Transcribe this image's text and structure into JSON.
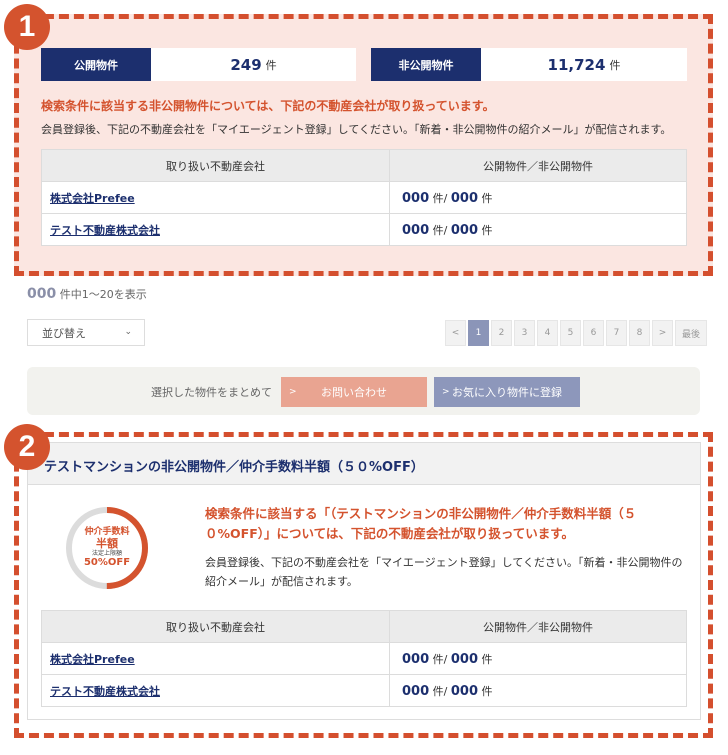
{
  "badges": {
    "one": "1",
    "two": "2"
  },
  "stats": {
    "public": {
      "label": "公開物件",
      "value": "249",
      "unit": "件"
    },
    "private": {
      "label": "非公開物件",
      "value": "11,724",
      "unit": "件"
    }
  },
  "section1": {
    "notice_red": "検索条件に該当する非公開物件については、下記の不動産会社が取り扱っています。",
    "notice_body": "会員登録後、下記の不動産会社を「マイエージェント登録」してください。「新着・非公開物件の紹介メール」が配信されます。",
    "table": {
      "headers": [
        "取り扱い不動産会社",
        "公開物件／非公開物件"
      ],
      "rows": [
        {
          "name": "株式会社Prefee",
          "pub": "000",
          "pub_unit": "件/",
          "priv": "000",
          "priv_unit": "件"
        },
        {
          "name": "テスト不動産株式会社",
          "pub": "000",
          "pub_unit": "件/",
          "priv": "000",
          "priv_unit": "件"
        }
      ]
    }
  },
  "results": {
    "count": "000",
    "text": "件中1～20を表示"
  },
  "sort": {
    "label": "並び替え"
  },
  "pagination": {
    "prev": "<",
    "pages": [
      "1",
      "2",
      "3",
      "4",
      "5",
      "6",
      "7",
      "8"
    ],
    "active": "1",
    "next": ">",
    "last": "最後"
  },
  "action_bar": {
    "caption": "選択した物件をまとめて",
    "inquiry": "お問い合わせ",
    "favorite": "お気に入り物件に登録",
    "arrow": ">"
  },
  "section2": {
    "title": "テストマンションの非公開物件／仲介手数料半額（５０%OFF）",
    "circle": {
      "line1": "仲介手数料",
      "line2": "半額",
      "line3": "法定上限額",
      "line4": "50%OFF",
      "percent": 0.5
    },
    "notice_red": "検索条件に該当する「（テストマンションの非公開物件／仲介手数料半額（５０%OFF）」については、下記の不動産会社が取り扱っています。",
    "notice_body": "会員登録後、下記の不動産会社を「マイエージェント登録」してください。「新着・非公開物件の紹介メール」が配信されます。",
    "table": {
      "headers": [
        "取り扱い不動産会社",
        "公開物件／非公開物件"
      ],
      "rows": [
        {
          "name": "株式会社Prefee",
          "pub": "000",
          "pub_unit": "件/",
          "priv": "000",
          "priv_unit": "件"
        },
        {
          "name": "テスト不動産株式会社",
          "pub": "000",
          "pub_unit": "件/",
          "priv": "000",
          "priv_unit": "件"
        }
      ]
    }
  },
  "colors": {
    "accent": "#d4532e",
    "navy": "#1c2f6e",
    "pink_bg": "#fbe6e1",
    "inquiry": "#e9a491",
    "favorite": "#8d97bb"
  }
}
